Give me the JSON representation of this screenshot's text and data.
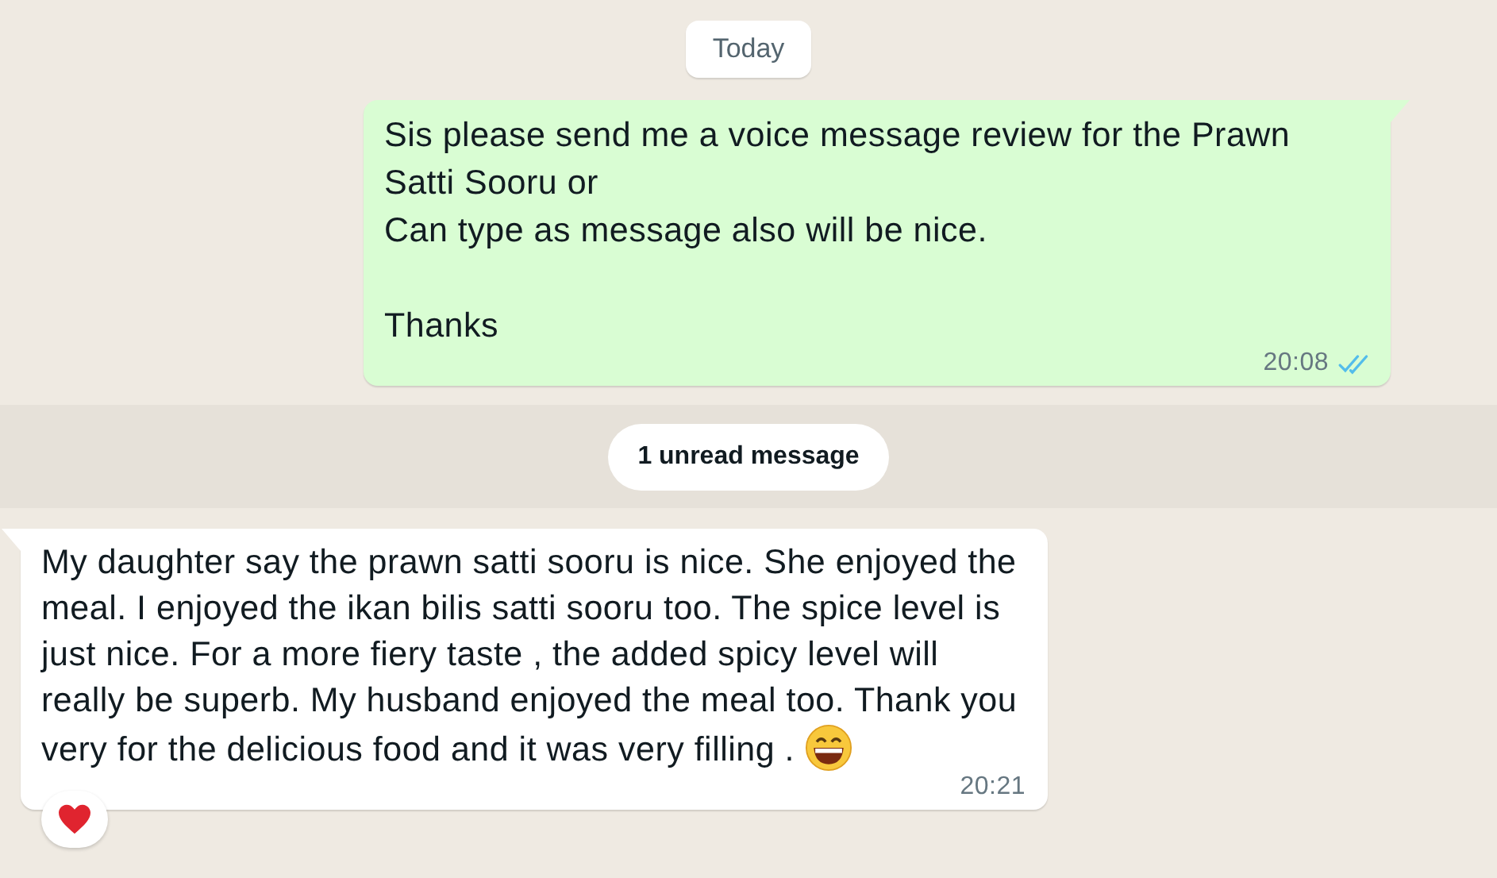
{
  "date_chip": "Today",
  "messages": [
    {
      "kind": "outgoing",
      "text": "Sis please send me a voice message review for the Prawn Satti Sooru or\nCan type as message also will be nice.\n\nThanks",
      "time": "20:08",
      "read": true
    },
    {
      "kind": "unread",
      "text": "1 unread message"
    },
    {
      "kind": "incoming",
      "text": "My daughter say the prawn satti sooru is nice. She enjoyed the meal. I enjoyed the ikan bilis satti sooru too. The spice level is just nice. For a more fiery taste , the added spicy level will really be superb. My husband enjoyed the meal too. Thank you very for the delicious food and it was very filling .",
      "time": "20:21",
      "emoji": true,
      "reaction": true
    }
  ]
}
